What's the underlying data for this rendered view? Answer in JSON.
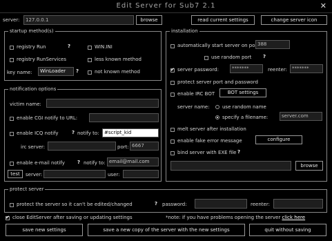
{
  "window": {
    "title": "Edit Server for Sub7 2.1"
  },
  "server": {
    "label": "server:",
    "value": "127.0.0.1",
    "browse": "browse",
    "read_settings": "read current settings",
    "change_icon": "change server icon"
  },
  "startup": {
    "legend": "startup method(s)",
    "registry_run": "registry Run",
    "win_ini": "WIN.INI",
    "registry_runservices": "registry RunServices",
    "less_known": "less known method",
    "key_name_label": "key name:",
    "key_name_value": "WinLoader",
    "not_known": "not known method"
  },
  "notification": {
    "legend": "notification options",
    "victim_name_label": "victim name:",
    "cgi_label": "enable CGI notify to URL:",
    "icq_label": "enable ICQ notify",
    "icq_to": "notify to:",
    "icq_value": "#script_kid",
    "irc_server_label": "irc server:",
    "irc_port_label": "port:",
    "irc_port_value": "6667",
    "email_label": "enable e-mail notify",
    "email_to": "notify to:",
    "email_value": "email@mail.com",
    "test_btn": "test",
    "smtp_label": "server:",
    "user_label": "user:"
  },
  "installation": {
    "legend": "installation",
    "auto_start_label": "automatically start server on port:",
    "port_value": "388",
    "random_port": "use random port",
    "server_password_label": "server password:",
    "server_password_value": "*******",
    "reenter_label": "reenter:",
    "reenter_value": "*******",
    "protect_port": "protect server port and password",
    "enable_ircbot": "enable IRC BOT",
    "bot_settings": "BOT settings",
    "server_name_label": "server name:",
    "use_random_name": "use random name",
    "specify_filename": "specify a filename:",
    "filename_value": "server.com",
    "melt_server": "melt server after installation",
    "fake_error": "enable fake error message",
    "configure_btn": "configure",
    "bind_exe": "bind server with EXE file",
    "browse_btn": "browse"
  },
  "protect": {
    "legend": "protect server",
    "checkbox": "protect the server so it can't be edited/changed",
    "password_label": "password:",
    "reenter_label": "reenter:"
  },
  "footer": {
    "close_after": "close EditServer after saving or updating settings",
    "note": "*note: if you have problems opening the server",
    "click_here": "click here",
    "save_new": "save new settings",
    "save_copy": "save a new copy of the server with the new settings",
    "quit": "quit without saving"
  },
  "colors": {
    "background": "#000000",
    "border": "#8a8a8a",
    "text": "#d8d8d8"
  }
}
